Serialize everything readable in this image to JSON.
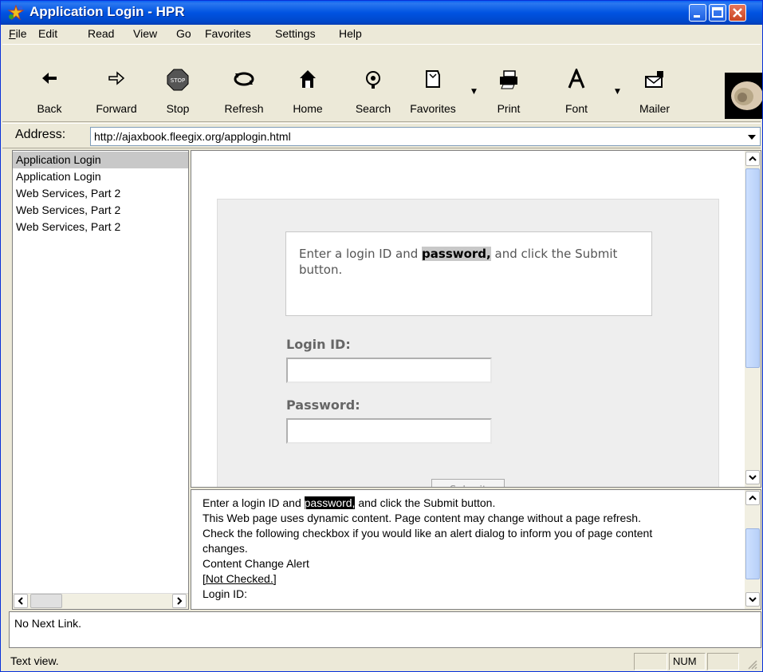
{
  "window": {
    "title": "Application Login - HPR"
  },
  "menu": {
    "file": "ile",
    "edit": "Edit",
    "read": "Read",
    "view": "View",
    "go": "Go",
    "favorites": "Favorites",
    "settings": "Settings",
    "help": "Help"
  },
  "toolbar": {
    "back": "Back",
    "forward": "Forward",
    "stop": "Stop",
    "refresh": "Refresh",
    "home": "Home",
    "search": "Search",
    "favorites": "Favorites",
    "print": "Print",
    "font": "Font",
    "mailer": "Mailer"
  },
  "address": {
    "label": "Address:",
    "value": "http://ajaxbook.fleegix.org/applogin.html"
  },
  "history": [
    "Application Login",
    "Application Login",
    "Web Services, Part 2",
    "Web Services, Part 2",
    "Web Services, Part 2"
  ],
  "form": {
    "instr_before": "Enter a login ID and ",
    "instr_highlight": "password,",
    "instr_after": " and click the Submit button.",
    "login_label": "Login ID:",
    "password_label": "Password:",
    "submit_label": "Submit"
  },
  "textview": {
    "l1_before": "Enter a login ID and ",
    "l1_highlight": "password,",
    "l1_after": " and click the Submit button.",
    "l2": "This Web page uses dynamic content. Page content may change without a page refresh.",
    "l3": "Check the following checkbox if you would like an alert dialog to inform you of page content",
    "l4": "changes.",
    "l5": "Content Change Alert",
    "l6": "[Not Checked.]",
    "l7": "Login ID:"
  },
  "status": {
    "next_link": "No Next Link.",
    "mode": "Text view.",
    "num": "NUM"
  }
}
